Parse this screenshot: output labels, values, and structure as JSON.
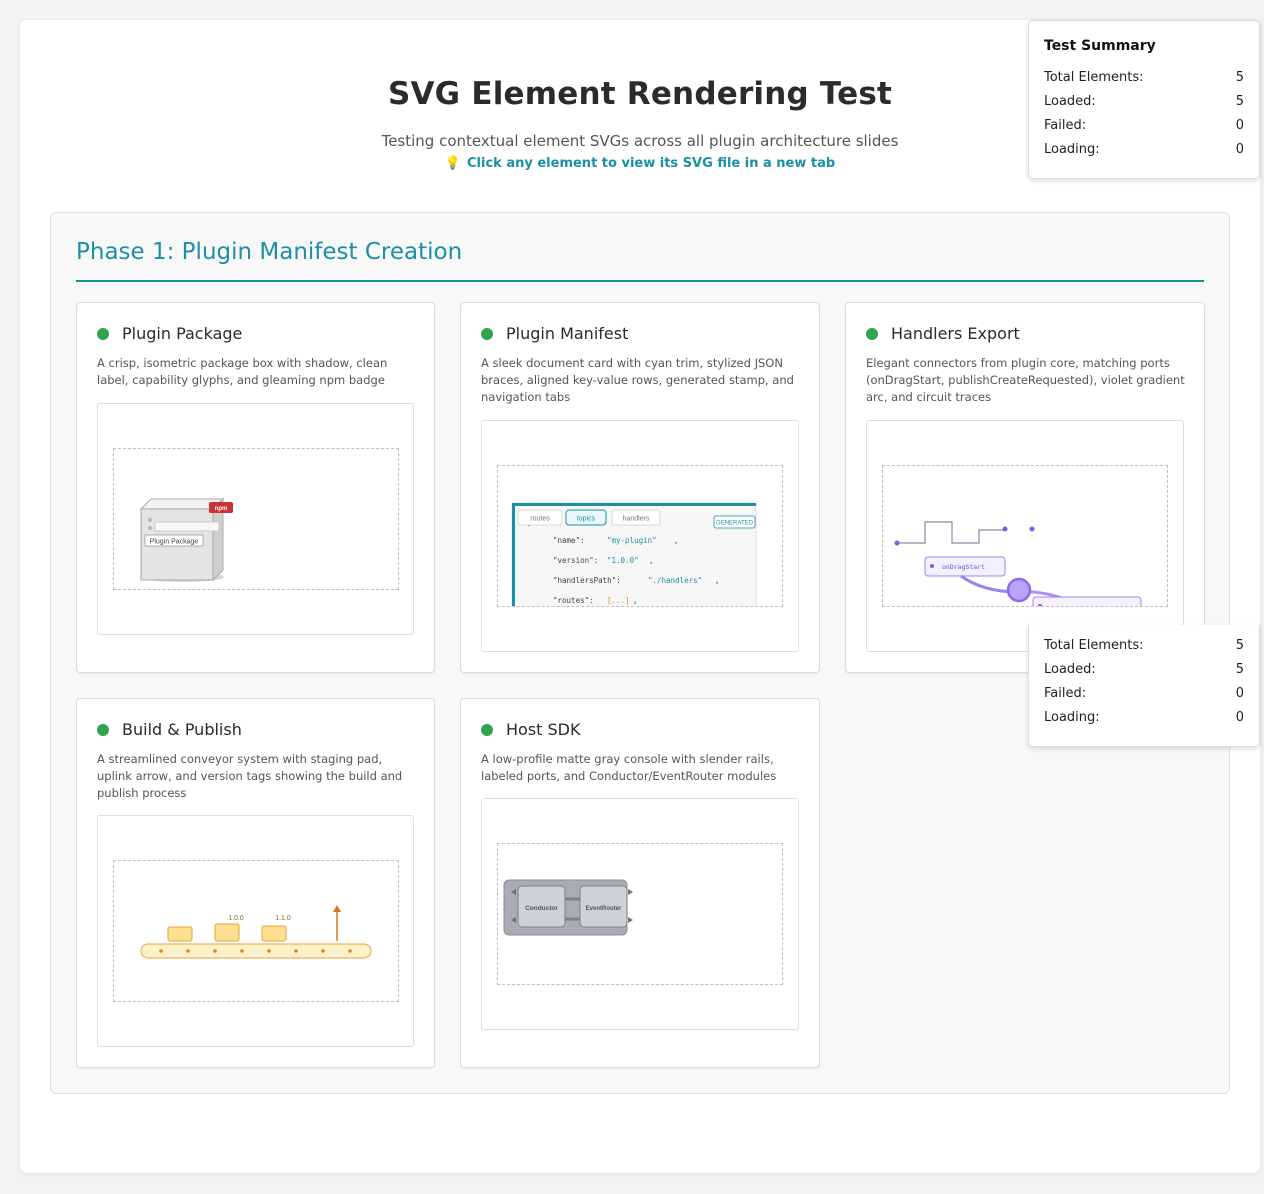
{
  "header": {
    "title": "SVG Element Rendering Test",
    "subtitle": "Testing contextual element SVGs across all plugin architecture slides",
    "hint_icon": "lightbulb-icon",
    "hint": "Click any element to view its SVG file in a new tab"
  },
  "phase": {
    "title": "Phase 1: Plugin Manifest Creation"
  },
  "colors": {
    "accent": "#1a8fa6",
    "status_loaded": "#2ea44f",
    "npm_red": "#cc3333",
    "violet": "#8b6cf0",
    "amber": "#e8a33a"
  },
  "cards": [
    {
      "title": "Plugin Package",
      "description": "A crisp, isometric package box with shadow, clean label, capability glyphs, and gleaming npm badge",
      "status": "loaded",
      "svg": {
        "label": "Plugin Package",
        "badge": "npm"
      }
    },
    {
      "title": "Plugin Manifest",
      "description": "A sleek document card with cyan trim, stylized JSON braces, aligned key-value rows, generated stamp, and navigation tabs",
      "status": "loaded",
      "svg": {
        "tabs": [
          "routes",
          "topics",
          "handlers"
        ],
        "stamp": "GENERATED",
        "rows": [
          {
            "key": "\"name\":",
            "value": "\"my-plugin\"",
            "tail": ","
          },
          {
            "key": "\"version\":",
            "value": "\"1.0.0\"",
            "tail": ","
          },
          {
            "key": "\"handlersPath\":",
            "value": "\"./handlers\"",
            "tail": ","
          },
          {
            "key": "\"routes\":",
            "value": "[...]",
            "tail": ","
          }
        ]
      }
    },
    {
      "title": "Handlers Export",
      "description": "Elegant connectors from plugin core, matching ports (onDragStart, publishCreateRequested), violet gradient arc, and circuit traces",
      "status": "loaded",
      "svg": {
        "port_label": "onDragStart"
      }
    },
    {
      "title": "Build & Publish",
      "description": "A streamlined conveyor system with staging pad, uplink arrow, and version tags showing the build and publish process",
      "status": "loaded",
      "svg": {
        "tags": [
          "1.0.0",
          "1.1.0"
        ]
      }
    },
    {
      "title": "Host SDK",
      "description": "A low-profile matte gray console with slender rails, labeled ports, and Conductor/EventRouter modules",
      "status": "loaded",
      "svg": {
        "modules": [
          "Conductor",
          "EventRouter"
        ]
      }
    }
  ],
  "summary": {
    "title": "Test Summary",
    "rows": [
      {
        "label": "Total Elements:",
        "value": 5
      },
      {
        "label": "Loaded:",
        "value": 5
      },
      {
        "label": "Failed:",
        "value": 0
      },
      {
        "label": "Loading:",
        "value": 0
      }
    ]
  }
}
